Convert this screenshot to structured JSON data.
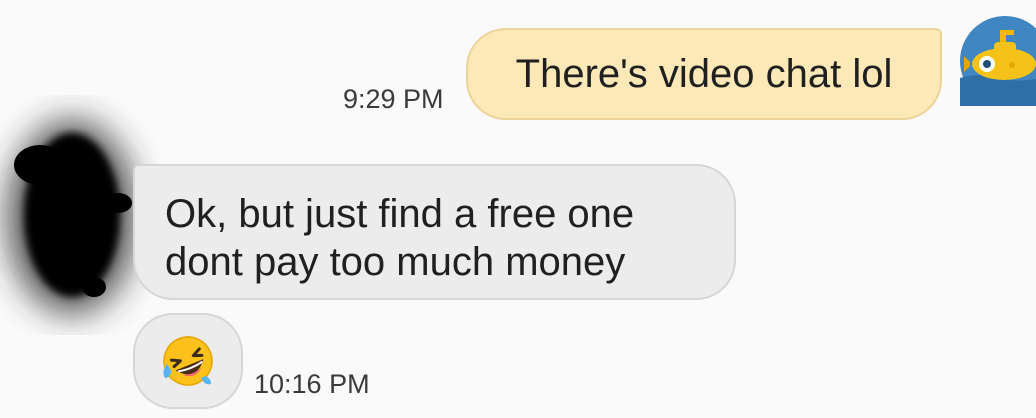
{
  "messages": {
    "outgoing": {
      "time": "9:29 PM",
      "text": "There's video chat lol",
      "avatar_icon": "submarine-icon"
    },
    "incoming": {
      "lines": [
        "Ok, but just find a free one",
        "dont pay too much money"
      ],
      "avatar_icon": "redacted-avatar"
    },
    "incoming_emoji": {
      "emoji_icon": "rolling-on-floor-laughing-emoji",
      "time": "10:16 PM"
    }
  },
  "colors": {
    "outgoing_bubble": "#fde8b8",
    "incoming_bubble": "#ececec",
    "background": "#fafafa",
    "avatar_bg": "#3f86c2"
  }
}
